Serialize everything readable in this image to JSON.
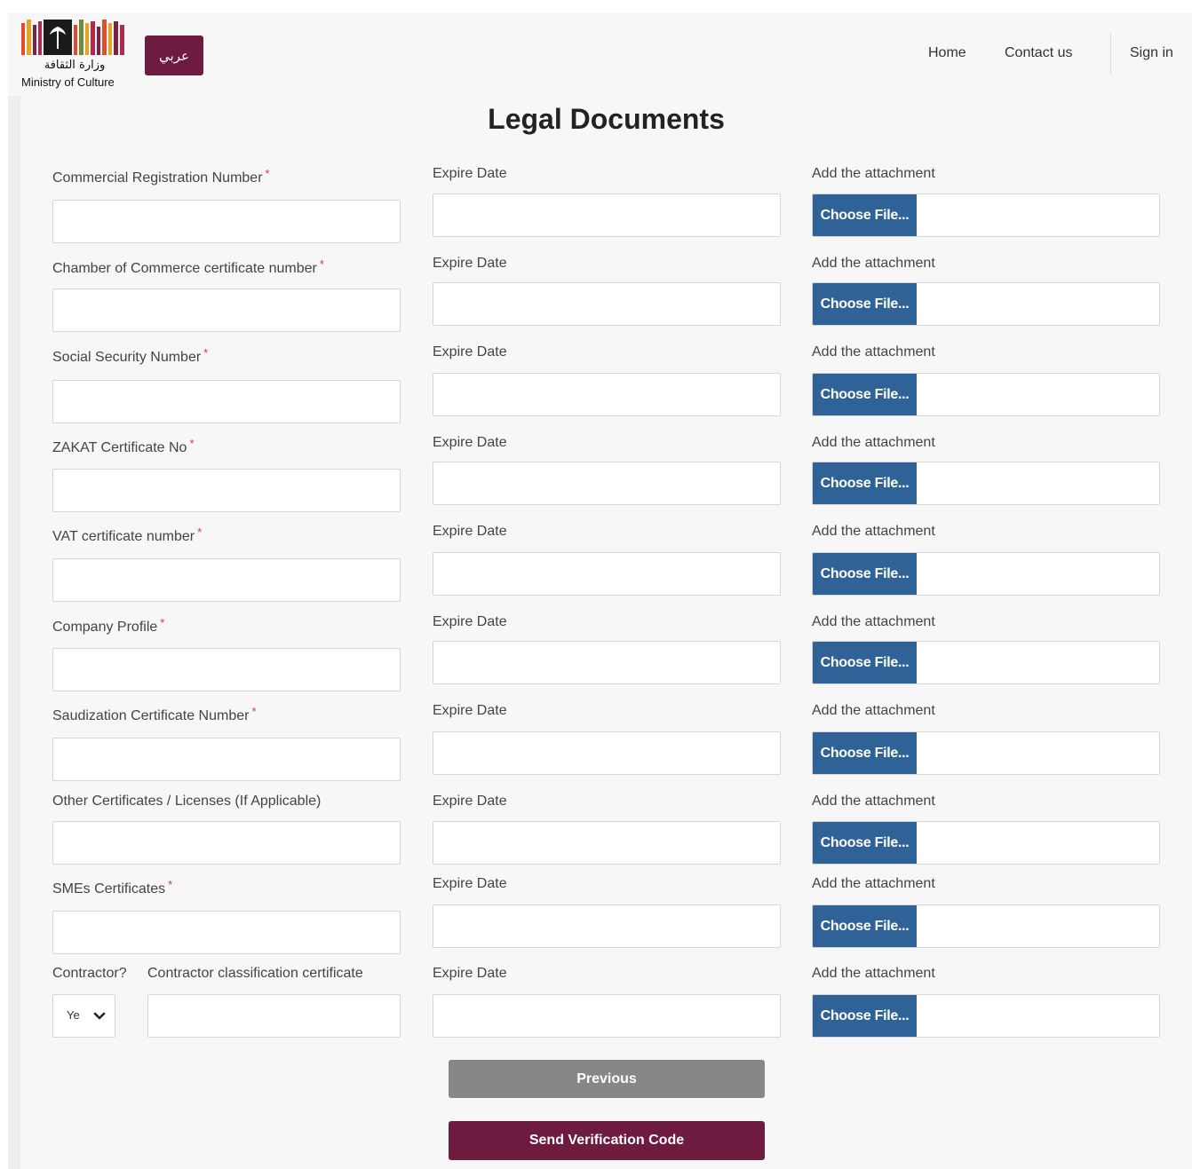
{
  "header": {
    "logo_arabic": "وزارة الثقافة",
    "logo_english": "Ministry of Culture",
    "lang_toggle": "عربي",
    "nav": {
      "home": "Home",
      "contact": "Contact us",
      "signin": "Sign in"
    }
  },
  "page_title": "Legal Documents",
  "columns": {
    "expire_label": "Expire Date",
    "attachment_label": "Add the attachment",
    "choose_file": "Choose File..."
  },
  "rows": [
    {
      "label": "Commercial Registration Number",
      "required": "*"
    },
    {
      "label": "Chamber of Commerce certificate number",
      "required": "*"
    },
    {
      "label": "Social Security Number",
      "required": "*"
    },
    {
      "label": "ZAKAT Certificate No",
      "required": "*"
    },
    {
      "label": "VAT certificate number",
      "required": "*"
    },
    {
      "label": "Company Profile",
      "required": "*"
    },
    {
      "label": "Saudization Certificate Number",
      "required": "*"
    },
    {
      "label": "Other Certificates / Licenses (If Applicable)",
      "required": ""
    },
    {
      "label": "SMEs Certificates",
      "required": "*"
    }
  ],
  "contractor": {
    "label": "Contractor?",
    "select_value": "Ye",
    "classification_label": "Contractor classification certificate"
  },
  "buttons": {
    "previous": "Previous",
    "send": "Send Verification Code"
  },
  "colors": {
    "brand": "#6e1b3f",
    "file_button": "#2f6296",
    "previous_button": "#878787",
    "required": "#d9343a"
  }
}
